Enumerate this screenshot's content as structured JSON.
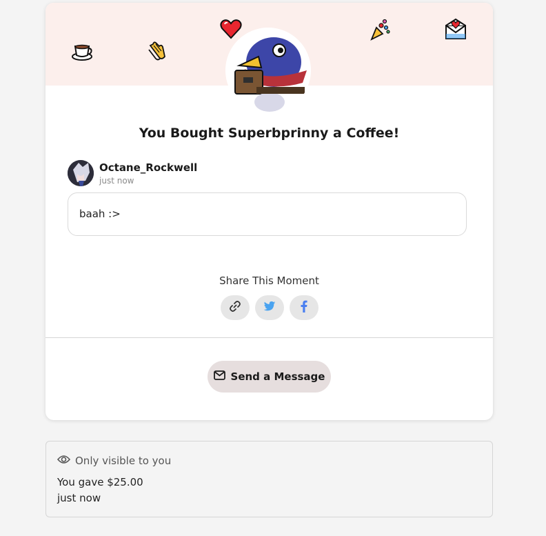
{
  "confirmation": {
    "title": "You Bought Superbprinny a Coffee!",
    "decorations": [
      "coffee-cup-icon",
      "clapping-hands-icon",
      "red-heart-icon",
      "party-popper-icon",
      "love-letter-icon"
    ]
  },
  "supporter": {
    "name": "Octane_Rockwell",
    "time": "just now",
    "message": "baah :>"
  },
  "share": {
    "label": "Share This Moment",
    "buttons": [
      "link-icon",
      "twitter-icon",
      "facebook-icon"
    ]
  },
  "actions": {
    "send_message_label": "Send a Message"
  },
  "private_note": {
    "visibility_label": "Only visible to you",
    "amount_text": "You gave $25.00",
    "time": "just now"
  },
  "colors": {
    "banner": "#fcefec",
    "twitter": "#4aa3f0",
    "facebook": "#4a7ff0",
    "send_button_bg": "#e6dede"
  }
}
